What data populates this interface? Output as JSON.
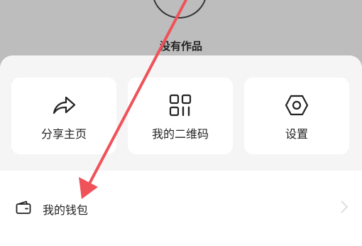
{
  "profile": {
    "status_text": "没有作品"
  },
  "actions": [
    {
      "label": "分享主页",
      "icon": "share-icon"
    },
    {
      "label": "我的二维码",
      "icon": "qr-code-icon"
    },
    {
      "label": "设置",
      "icon": "settings-icon"
    }
  ],
  "menu": {
    "wallet_label": "我的钱包",
    "wallet_icon": "wallet-icon"
  },
  "colors": {
    "annotation_arrow": "#f0525a",
    "backdrop": "#bdbdbd"
  }
}
